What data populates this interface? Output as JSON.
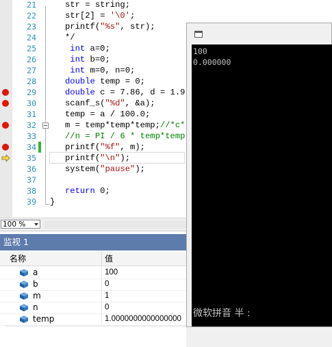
{
  "editor": {
    "lines": [
      {
        "num": "21",
        "text": "   str = string;",
        "breakpoint": false,
        "fold": false
      },
      {
        "num": "22",
        "text": "   str[2] = '\\0';",
        "breakpoint": false,
        "fold": false
      },
      {
        "num": "23",
        "text": "   printf(\"%s\", str);",
        "breakpoint": false,
        "fold": false
      },
      {
        "num": "24",
        "text": "   */",
        "breakpoint": false,
        "fold": false
      },
      {
        "num": "25",
        "text": "    int a=0;",
        "breakpoint": false,
        "fold": false
      },
      {
        "num": "26",
        "text": "    int b=0;",
        "breakpoint": false,
        "fold": false
      },
      {
        "num": "27",
        "text": "    int m=0, n=0;",
        "breakpoint": false,
        "fold": false
      },
      {
        "num": "28",
        "text": "   double temp = 0;",
        "breakpoint": false,
        "fold": false
      },
      {
        "num": "29",
        "text": "   double c = 7.86, d = 1.9",
        "breakpoint": true,
        "fold": false
      },
      {
        "num": "30",
        "text": "   scanf_s(\"%d\", &a);",
        "breakpoint": true,
        "fold": false
      },
      {
        "num": "31",
        "text": "   temp = a / 100.0;",
        "breakpoint": false,
        "fold": false
      },
      {
        "num": "32",
        "text": "   m = temp*temp*temp;//*c*",
        "breakpoint": true,
        "fold": true
      },
      {
        "num": "33",
        "text": "   //n = PI / 6 * temp*temp",
        "breakpoint": false,
        "fold": false
      },
      {
        "num": "34",
        "text": "   printf(\"%f\", m);",
        "breakpoint": true,
        "fold": false
      },
      {
        "num": "35",
        "text": "   printf(\"\\n\");",
        "breakpoint": false,
        "fold": false
      },
      {
        "num": "36",
        "text": "   system(\"pause\");",
        "breakpoint": false,
        "fold": false
      },
      {
        "num": "37",
        "text": "",
        "breakpoint": false,
        "fold": false
      },
      {
        "num": "38",
        "text": "   return 0;",
        "breakpoint": false,
        "fold": false
      },
      {
        "num": "39",
        "text": "}",
        "breakpoint": false,
        "fold": false
      }
    ],
    "current_line": "35",
    "changed_line": "34",
    "colors": {
      "keyword": "#0000ff",
      "string": "#a31515",
      "comment": "#008000",
      "number": "#000000",
      "breakpoint": "#e51400",
      "line_number": "#2b91af"
    }
  },
  "zoom": {
    "value": "100 %"
  },
  "watch": {
    "title": "监视 1",
    "columns": {
      "name": "名称",
      "value": "值"
    },
    "rows": [
      {
        "name": "a",
        "value": "100"
      },
      {
        "name": "b",
        "value": "0"
      },
      {
        "name": "m",
        "value": "1"
      },
      {
        "name": "n",
        "value": "0"
      },
      {
        "name": "temp",
        "value": "1.0000000000000000"
      }
    ],
    "title_color": "#5d7bab"
  },
  "console": {
    "lines": [
      "100",
      "0.000000"
    ],
    "ime_status": "微软拼音 半 :"
  }
}
